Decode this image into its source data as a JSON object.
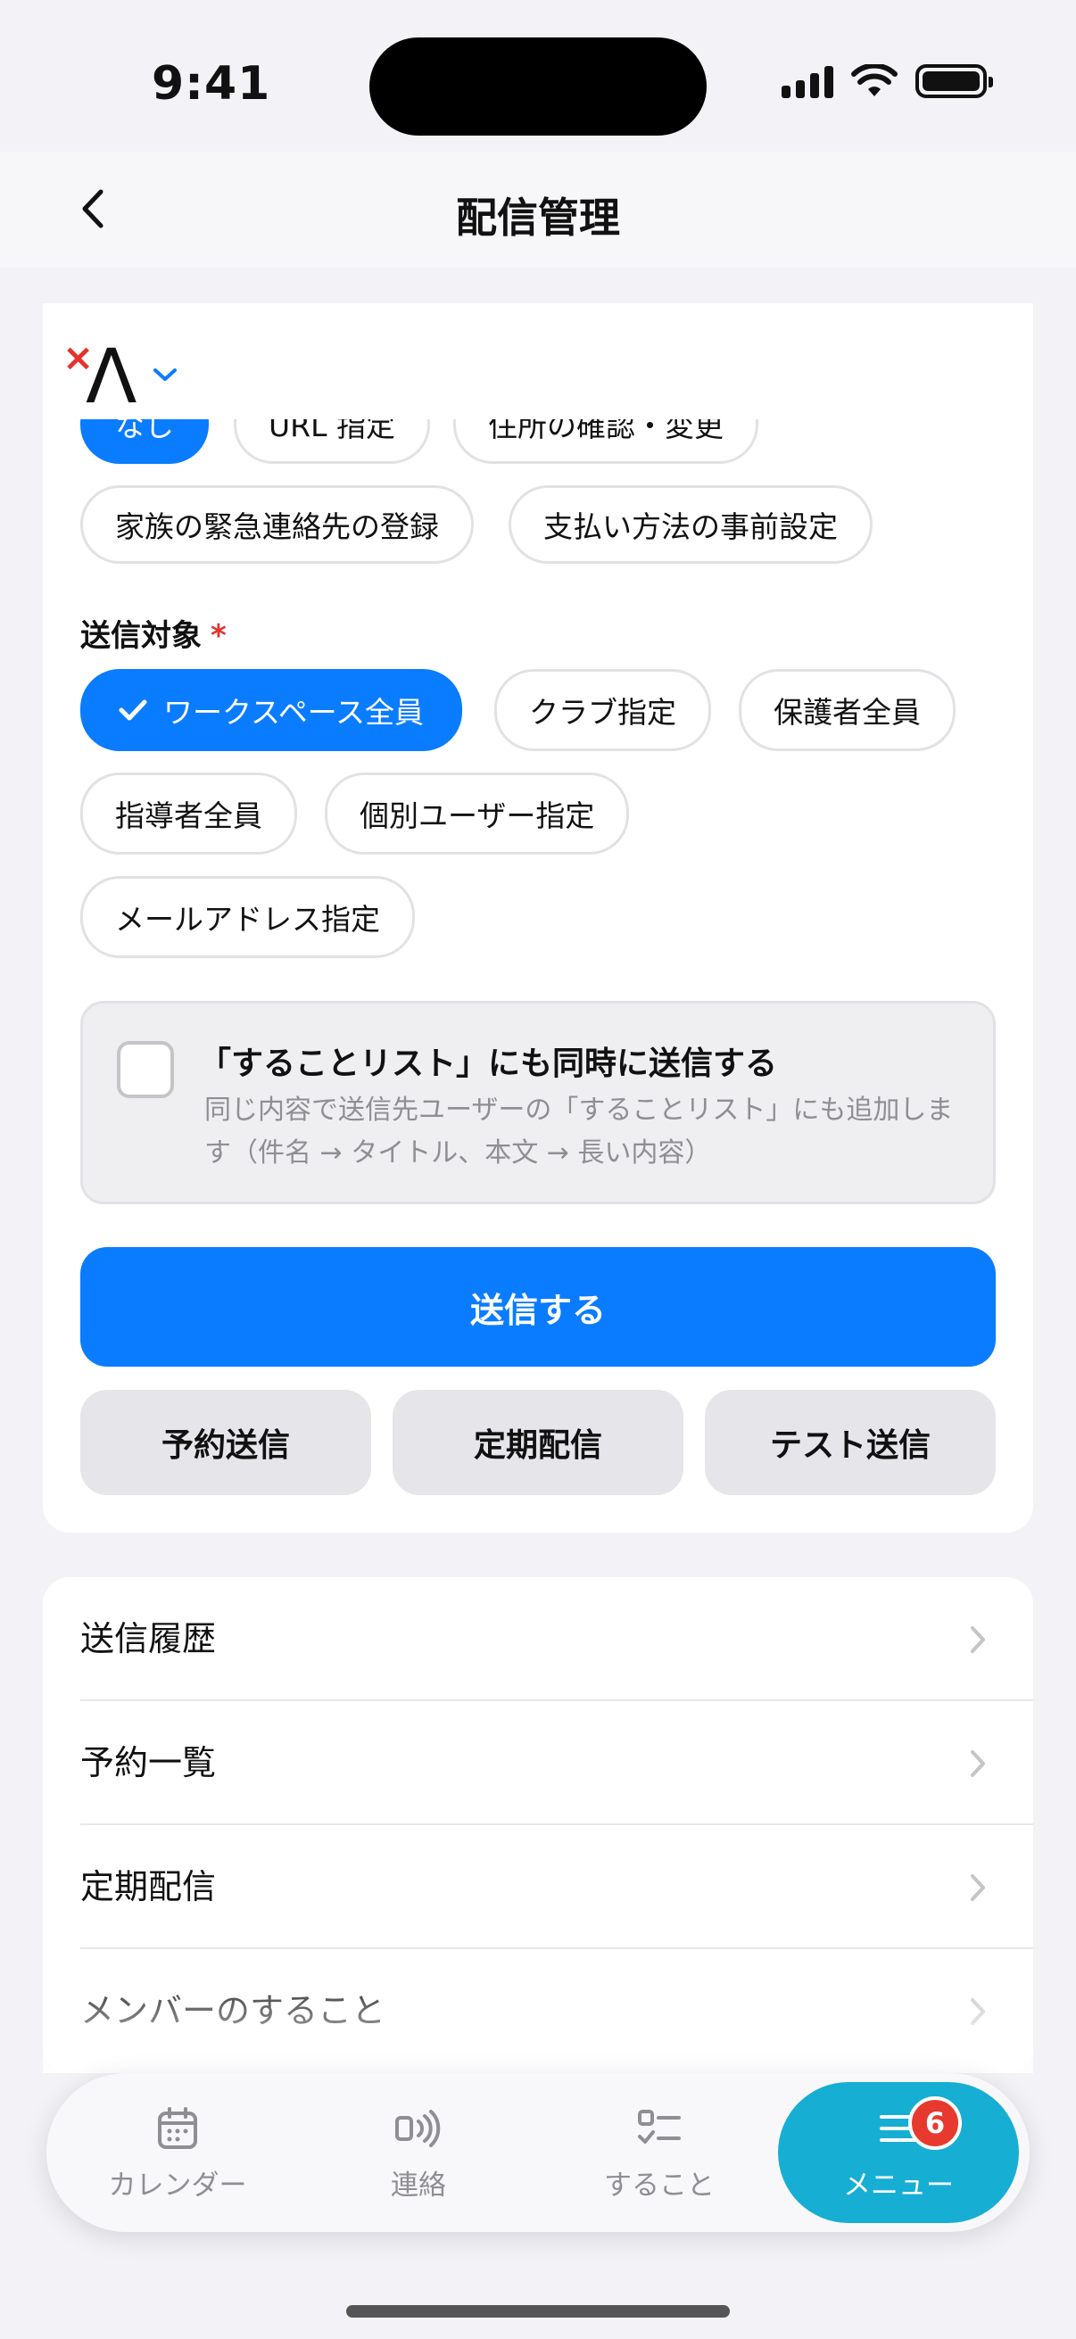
{
  "status": {
    "time": "9:41"
  },
  "nav": {
    "title": "配信管理"
  },
  "options_top": [
    "なし",
    "URL 指定",
    "住所の確認・変更"
  ],
  "options_row2": [
    "家族の緊急連絡先の登録",
    "支払い方法の事前設定"
  ],
  "target": {
    "label": "送信対象",
    "required_mark": "*",
    "chips": [
      "ワークスペース全員",
      "クラブ指定",
      "保護者全員",
      "指導者全員",
      "個別ユーザー指定",
      "メールアドレス指定"
    ],
    "selected": "ワークスペース全員"
  },
  "todo": {
    "title": "「することリスト」にも同時に送信する",
    "desc": "同じ内容で送信先ユーザーの「することリスト」にも追加します（件名 → タイトル、本文 → 長い内容）",
    "checked": false
  },
  "actions": {
    "send": "送信する",
    "scheduled": "予約送信",
    "recurring": "定期配信",
    "test": "テスト送信"
  },
  "list": [
    "送信履歴",
    "予約一覧",
    "定期配信",
    "メンバーのすること"
  ],
  "tabs": {
    "calendar": "カレンダー",
    "contact": "連絡",
    "todo": "すること",
    "menu": "メニュー",
    "menu_badge": "6"
  },
  "colors": {
    "accent": "#0a7cff",
    "tab_active": "#17aed4",
    "badge": "#e8392f",
    "required": "#e5322d"
  }
}
